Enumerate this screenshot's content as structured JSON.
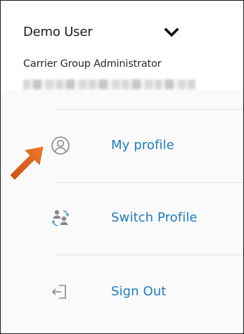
{
  "user": {
    "name": "Demo User",
    "role": "Carrier Group Administrator",
    "toggle_icon": "chevron-down-icon"
  },
  "menu": {
    "items": [
      {
        "label": "My profile",
        "icon": "user-circle-icon"
      },
      {
        "label": "Switch Profile",
        "icon": "switch-users-icon"
      },
      {
        "label": "Sign Out",
        "icon": "sign-out-icon"
      }
    ]
  },
  "colors": {
    "link": "#1f7bbf",
    "icon": "#8a8a8a",
    "arrow": "#e0661f"
  }
}
